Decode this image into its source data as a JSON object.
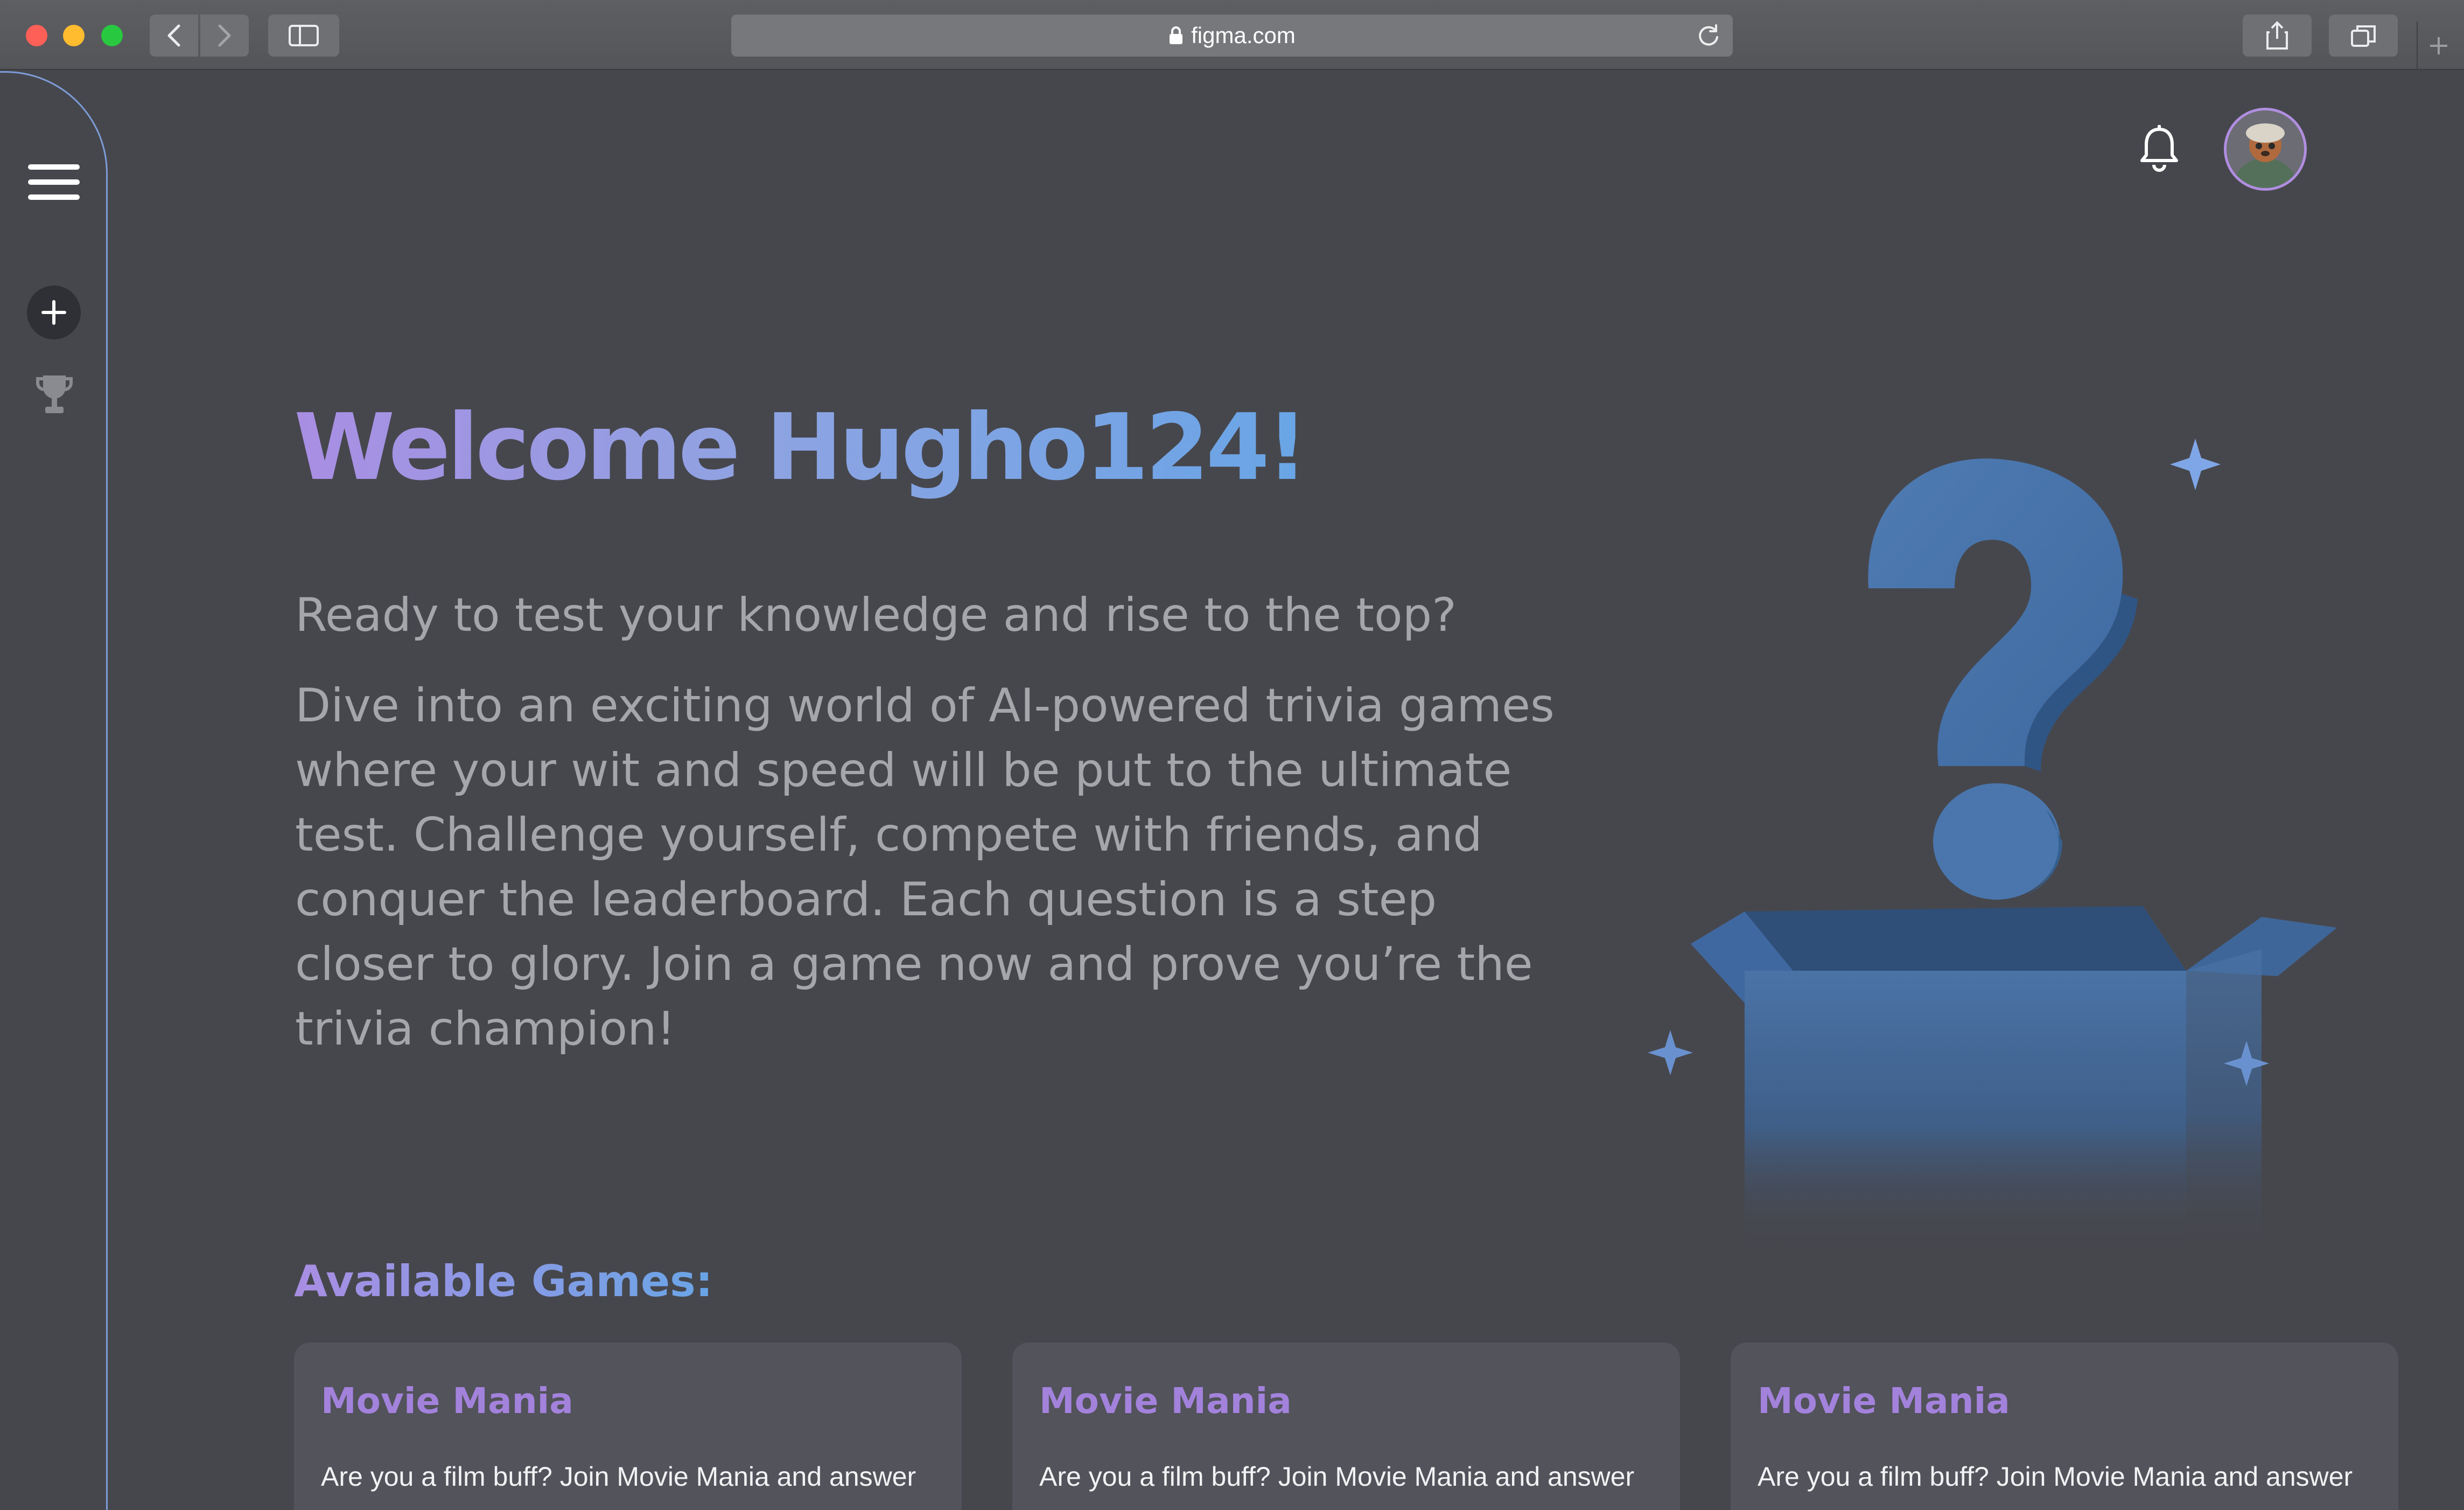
{
  "browser": {
    "url": "figma.com"
  },
  "header": {
    "notifications_icon": "bell-icon",
    "avatar_alt": "User avatar"
  },
  "sidebar": {
    "menu_icon": "hamburger-icon",
    "items": [
      {
        "icon": "plus-icon",
        "label": "Create game"
      },
      {
        "icon": "trophy-icon",
        "label": "Leaderboard"
      }
    ]
  },
  "hero": {
    "welcome": "Welcome Hugho124!",
    "subtitle": "Ready to test your knowledge and rise to the top?",
    "description": "Dive into an exciting world of AI-powered trivia games where your wit and speed will be put to the ultimate test. Challenge yourself, compete with friends, and conquer the leaderboard. Each question is a step closer to glory. Join a game now and prove you’re the trivia champion!"
  },
  "games": {
    "section_title": "Available Games:",
    "cards": [
      {
        "title": "Movie Mania",
        "description": "Are you a film buff? Join Movie Mania and answer"
      },
      {
        "title": "Movie Mania",
        "description": "Are you a film buff? Join Movie Mania and answer"
      },
      {
        "title": "Movie Mania",
        "description": "Are you a film buff? Join Movie Mania and answer"
      }
    ]
  },
  "colors": {
    "background": "#46474d",
    "card": "#52535b",
    "accent_purple": "#a382dc",
    "accent_blue": "#69a5e6",
    "rail_border": "#7d9bd6"
  }
}
